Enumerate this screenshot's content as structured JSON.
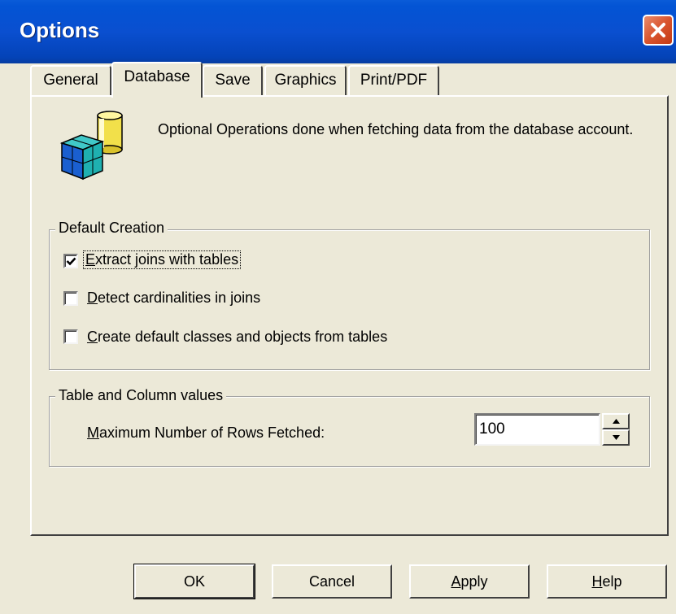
{
  "window": {
    "title": "Options"
  },
  "tabs": [
    {
      "label": "General"
    },
    {
      "label": "Database"
    },
    {
      "label": "Save"
    },
    {
      "label": "Graphics"
    },
    {
      "label": "Print/PDF"
    }
  ],
  "active_tab": "Database",
  "description": "Optional Operations done when fetching data from the database account.",
  "default_creation": {
    "legend": "Default Creation",
    "options": [
      {
        "mnemonic": "E",
        "rest": "xtract joins with tables",
        "checked": true
      },
      {
        "mnemonic": "D",
        "rest": "etect cardinalities in joins",
        "checked": false
      },
      {
        "mnemonic": "C",
        "rest": "reate default classes and objects from tables",
        "checked": false
      }
    ]
  },
  "table_column": {
    "legend": "Table and Column values",
    "label_mnemonic": "M",
    "label_rest": "aximum Number of Rows Fetched:",
    "value": "100"
  },
  "buttons": {
    "ok": "OK",
    "cancel": "Cancel",
    "apply_mnemonic": "A",
    "apply_rest": "pply",
    "help_mnemonic": "H",
    "help_rest": "elp"
  },
  "colors": {
    "titlebar": "#0a4fd0",
    "dialog_bg": "#ece9d8",
    "close_button": "#d9542e"
  },
  "icons": {
    "close": "close-icon",
    "database": "database-cube-icon",
    "check": "checkmark-icon",
    "spin_up": "arrow-up-icon",
    "spin_down": "arrow-down-icon"
  }
}
